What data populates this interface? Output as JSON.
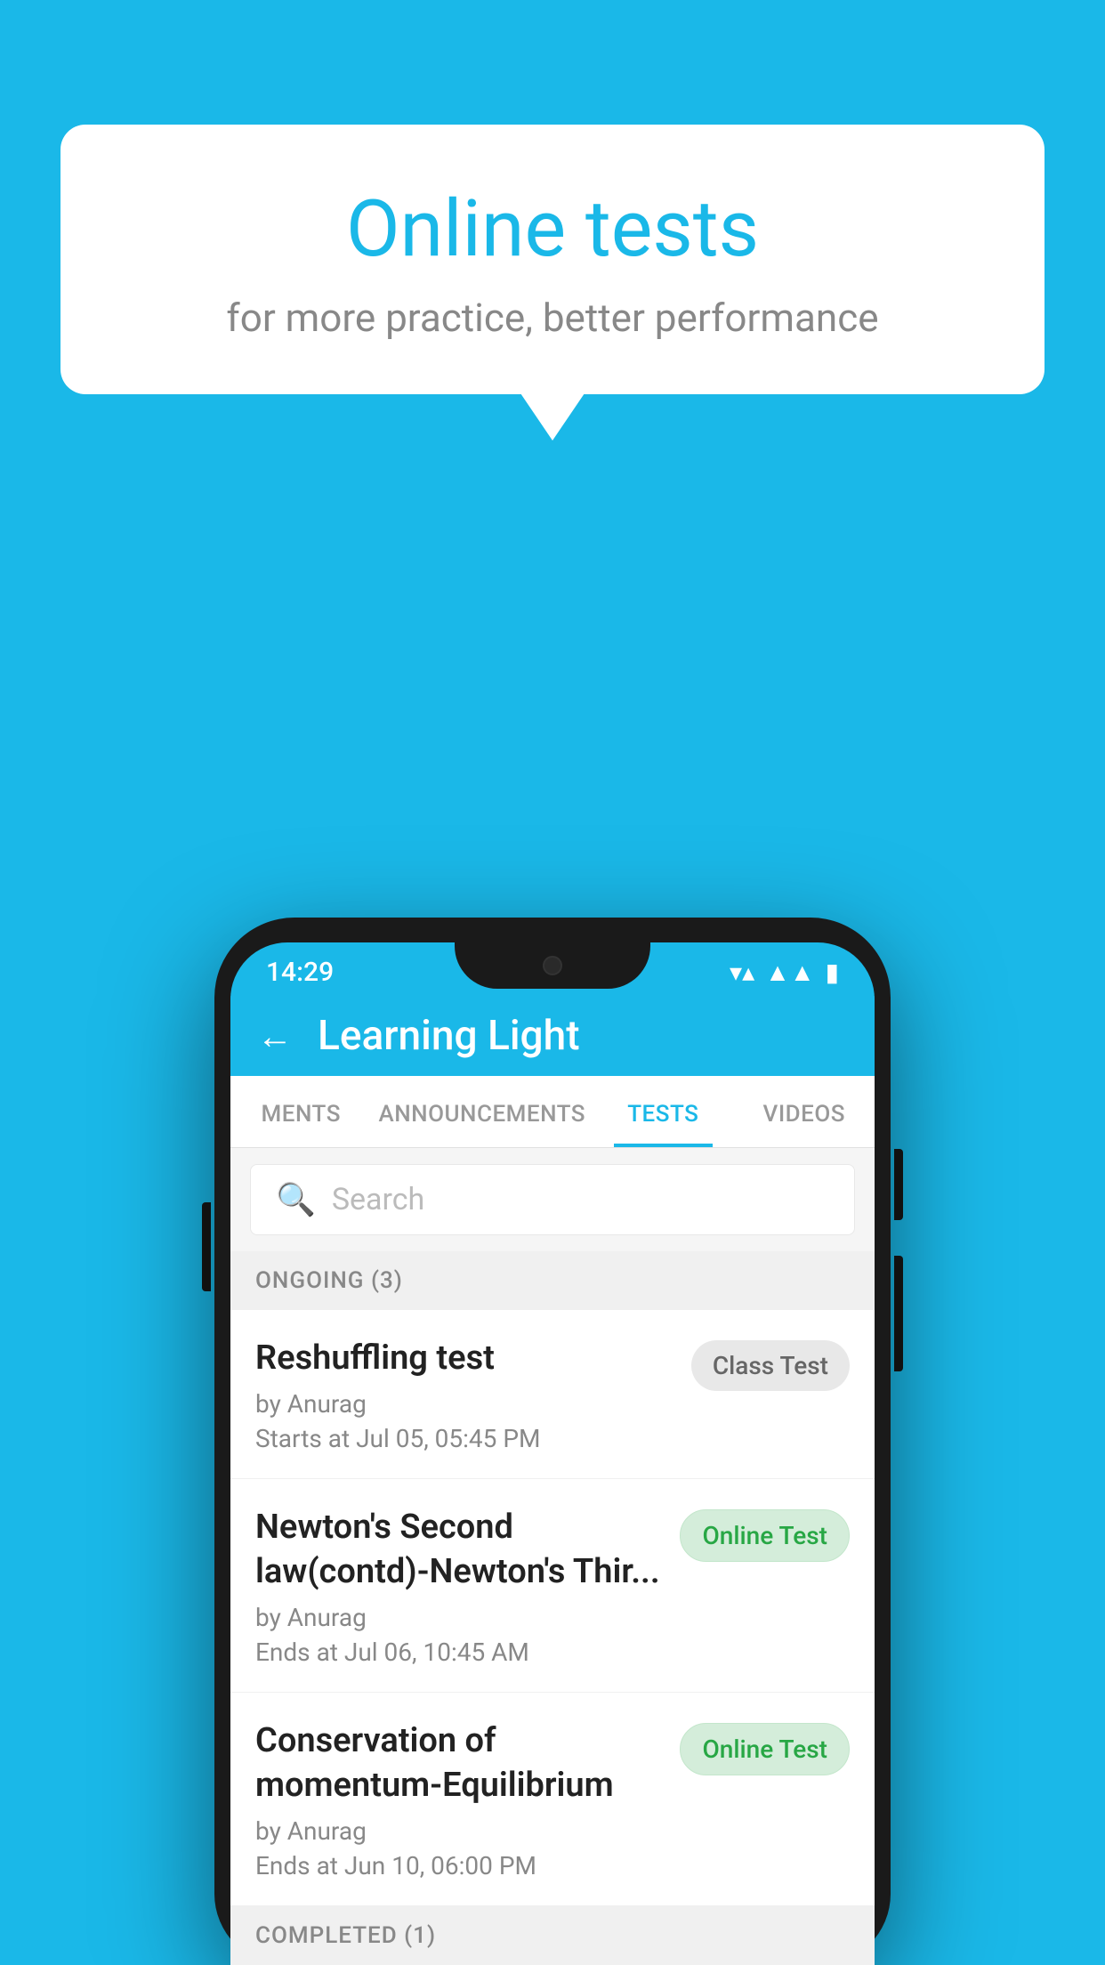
{
  "background_color": "#1ab8e8",
  "bubble": {
    "title": "Online tests",
    "subtitle": "for more practice, better performance"
  },
  "phone": {
    "status_bar": {
      "time": "14:29",
      "icons": [
        "wifi",
        "signal",
        "battery"
      ]
    },
    "header": {
      "title": "Learning Light",
      "back_label": "←"
    },
    "tabs": [
      {
        "label": "MENTS",
        "active": false
      },
      {
        "label": "ANNOUNCEMENTS",
        "active": false
      },
      {
        "label": "TESTS",
        "active": true
      },
      {
        "label": "VIDEOS",
        "active": false
      }
    ],
    "search": {
      "placeholder": "Search"
    },
    "ongoing_section": {
      "label": "ONGOING (3)"
    },
    "tests": [
      {
        "title": "Reshuffling test",
        "author": "by Anurag",
        "time_label": "Starts at",
        "time": "Jul 05, 05:45 PM",
        "badge": "Class Test",
        "badge_type": "class"
      },
      {
        "title": "Newton's Second law(contd)-Newton's Thir...",
        "author": "by Anurag",
        "time_label": "Ends at",
        "time": "Jul 06, 10:45 AM",
        "badge": "Online Test",
        "badge_type": "online"
      },
      {
        "title": "Conservation of momentum-Equilibrium",
        "author": "by Anurag",
        "time_label": "Ends at",
        "time": "Jun 10, 06:00 PM",
        "badge": "Online Test",
        "badge_type": "online"
      }
    ],
    "completed_section": {
      "label": "COMPLETED (1)"
    }
  }
}
